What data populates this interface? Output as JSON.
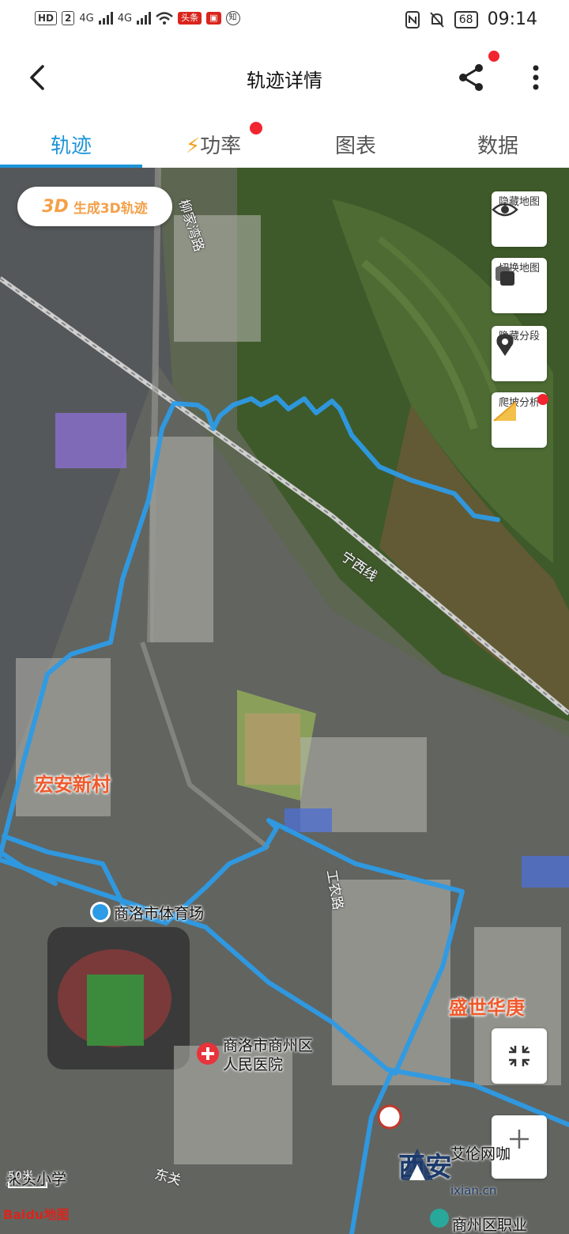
{
  "status_bar": {
    "network": "HD",
    "sim": "2",
    "signal1": "4G",
    "signal2": "4G",
    "app1": "头条",
    "app2": "知",
    "battery": "68",
    "time": "09:14"
  },
  "header": {
    "title": "轨迹详情"
  },
  "tabs": [
    {
      "label": "轨迹",
      "active": true
    },
    {
      "label": "功率",
      "active": false,
      "has_dot": true
    },
    {
      "label": "图表",
      "active": false
    },
    {
      "label": "数据",
      "active": false
    }
  ],
  "map": {
    "generate_3d": {
      "badge": "3D",
      "label": "生成3D轨迹"
    },
    "side_buttons": [
      {
        "icon": "eye-icon",
        "label": "隐藏地图"
      },
      {
        "icon": "layers-icon",
        "label": "切换地图"
      },
      {
        "icon": "location-pin-icon",
        "label": "隐藏分段"
      },
      {
        "icon": "slope-icon",
        "label": "爬坡分析"
      }
    ],
    "area_labels": [
      "宏安新村",
      "盛世华庚"
    ],
    "pois": [
      "商洛市体育场",
      "商洛市商州区\n人民医院",
      "米头小学",
      "艾伦网咖",
      "商州区职业"
    ],
    "roads": [
      "柳家湾路",
      "宁西线",
      "东关",
      "工农路"
    ],
    "scale": "50米",
    "logo": "Baidu地图",
    "watermark": {
      "main": "西安",
      "site": "ixian.cn"
    }
  }
}
